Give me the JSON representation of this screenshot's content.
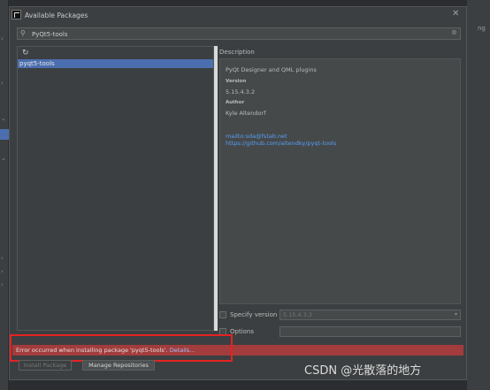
{
  "dialog": {
    "title": "Available Packages",
    "search": {
      "value": "PyQt5-tools",
      "placeholder": ""
    },
    "packages": [
      "pyqt5-tools"
    ],
    "description": {
      "label": "Description",
      "summary": "PyQt Designer and QML plugins",
      "version_header": "Version",
      "version": "5.15.4.3.2",
      "author_header": "Author",
      "author": "Kyle Altendorf",
      "email_link": "mailto:sda@fstab.net",
      "url_link": "https://github.com/altendky/pyqt-tools"
    },
    "specify_version_label": "Specify version",
    "specify_version_value": "5.15.4.3.2",
    "options_label": "Options",
    "error": {
      "text": "Error occurred when installing package 'pyqt5-tools'.",
      "link": "Details..."
    },
    "buttons": {
      "install": "Install Package",
      "manage": "Manage Repositories"
    }
  },
  "background": {
    "right_text": "ng"
  },
  "watermark": "CSDN @光散落的地方"
}
